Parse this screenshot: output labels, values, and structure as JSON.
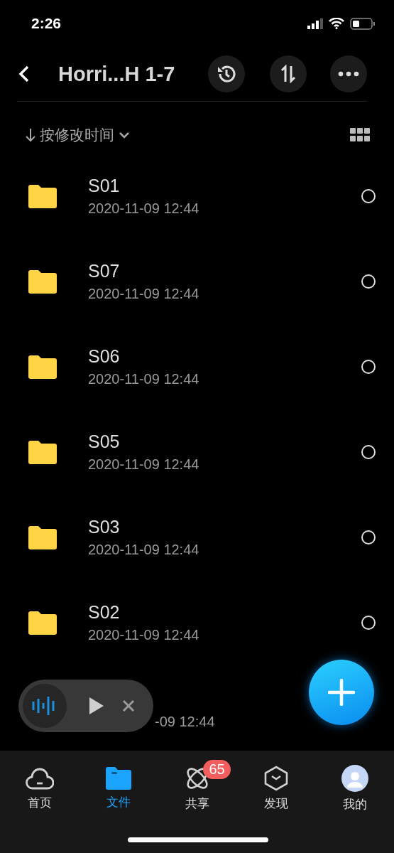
{
  "status_bar": {
    "time": "2:26"
  },
  "header": {
    "title": "Horri...H 1-7"
  },
  "sort": {
    "label": "按修改时间"
  },
  "files": [
    {
      "name": "S01",
      "modified": "2020-11-09 12:44",
      "selected": false
    },
    {
      "name": "S07",
      "modified": "2020-11-09 12:44",
      "selected": false
    },
    {
      "name": "S06",
      "modified": "2020-11-09 12:44",
      "selected": false
    },
    {
      "name": "S05",
      "modified": "2020-11-09 12:44",
      "selected": false
    },
    {
      "name": "S03",
      "modified": "2020-11-09 12:44",
      "selected": false
    },
    {
      "name": "S02",
      "modified": "2020-11-09 12:44",
      "selected": false
    },
    {
      "kind": "partial",
      "modified": "-09 12:44"
    }
  ],
  "tabs": [
    {
      "label": "首页",
      "kind": "home",
      "selected": false
    },
    {
      "label": "文件",
      "kind": "files",
      "selected": true
    },
    {
      "label": "共享",
      "kind": "share",
      "selected": false,
      "badge": "65"
    },
    {
      "label": "发现",
      "kind": "discover",
      "selected": false
    },
    {
      "label": "我的",
      "kind": "me",
      "selected": false
    }
  ]
}
